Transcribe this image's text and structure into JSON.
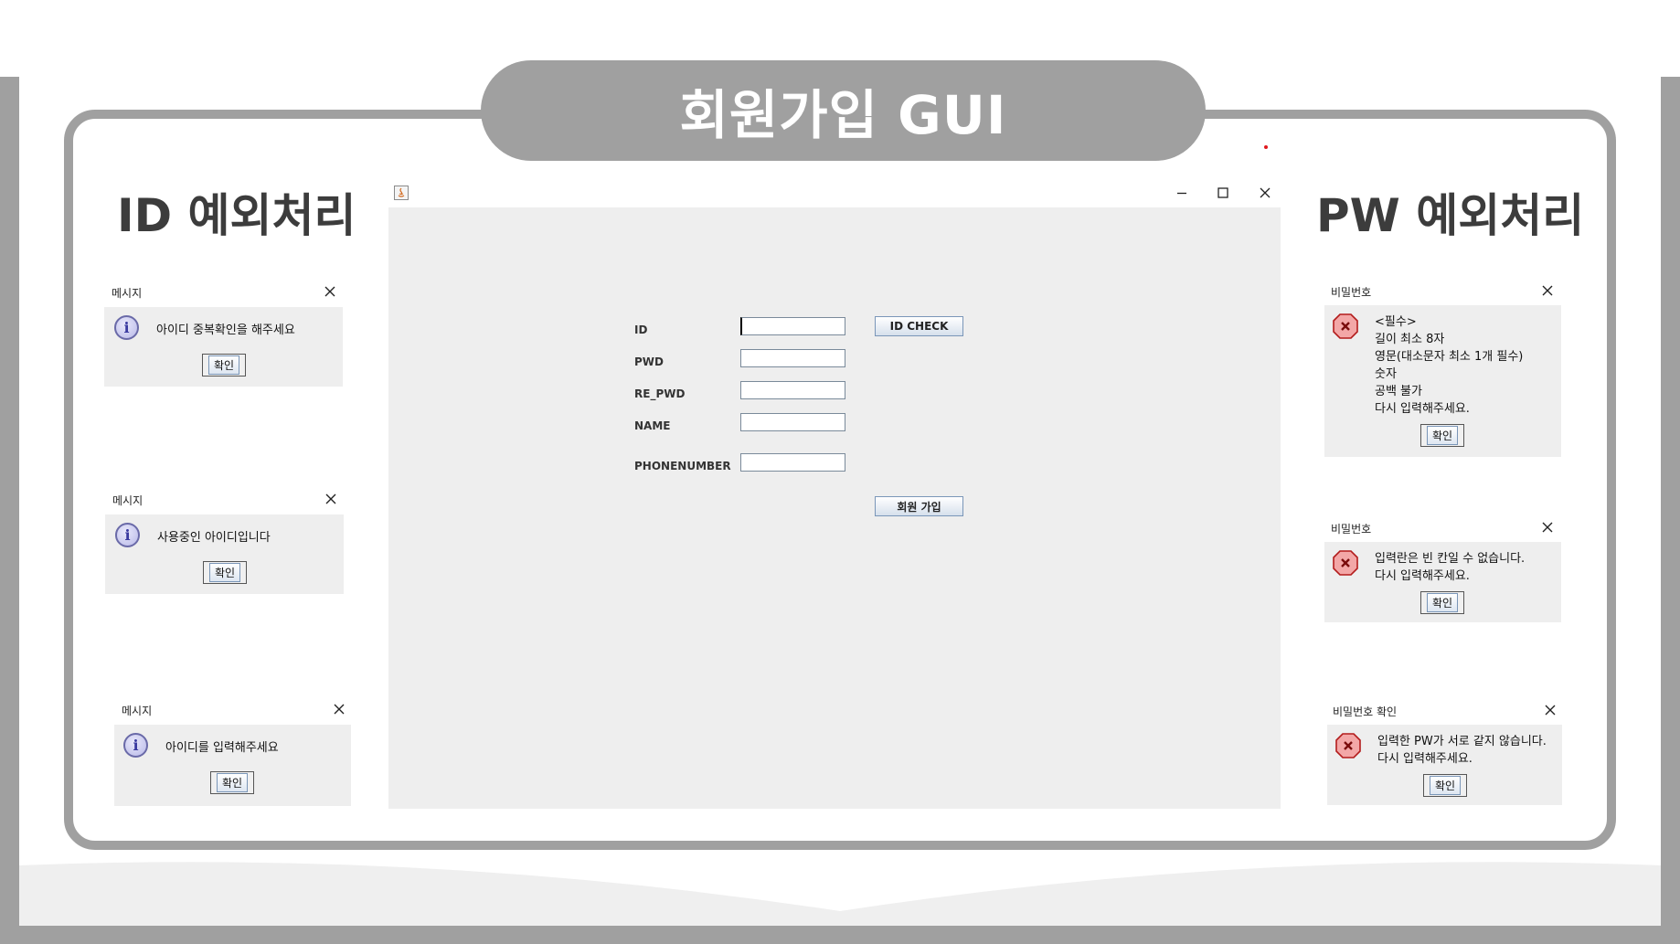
{
  "banner": {
    "title": "회원가입 GUI"
  },
  "sections": {
    "id_title": "ID 예외처리",
    "pw_title": "PW 예외처리"
  },
  "id_dialogs": [
    {
      "title": "메시지",
      "message": "아이디 중복확인을 해주세요",
      "button": "확인",
      "icon": "info-icon"
    },
    {
      "title": "메시지",
      "message": "사용중인 아이디입니다",
      "button": "확인",
      "icon": "info-icon"
    },
    {
      "title": "메시지",
      "message": "아이디를 입력해주세요",
      "button": "확인",
      "icon": "info-icon"
    }
  ],
  "pw_dialogs": [
    {
      "title": "비밀번호",
      "lines": [
        "<필수>",
        "길이 최소 8자",
        "영문(대소문자 최소 1개 필수)",
        "숫자",
        "공백 불가",
        "다시 입력해주세요."
      ],
      "button": "확인",
      "icon": "error-icon"
    },
    {
      "title": "비밀번호",
      "lines": [
        "입력란은 빈 칸일 수 없습니다.",
        "다시 입력해주세요."
      ],
      "button": "확인",
      "icon": "error-icon"
    },
    {
      "title": "비밀번호 확인",
      "lines": [
        "입력한 PW가 서로 같지 않습니다.",
        "다시 입력해주세요."
      ],
      "button": "확인",
      "icon": "error-icon"
    }
  ],
  "window": {
    "controls": [
      "minimize-icon",
      "maximize-icon",
      "close-icon"
    ],
    "form": {
      "fields": [
        {
          "label": "ID",
          "value": ""
        },
        {
          "label": "PWD",
          "value": ""
        },
        {
          "label": "RE_PWD",
          "value": ""
        },
        {
          "label": "NAME",
          "value": ""
        },
        {
          "label": "PHONENUMBER",
          "value": ""
        }
      ],
      "id_check_button": "ID CHECK",
      "submit_button": "회원 가입"
    }
  },
  "colors": {
    "frame": "#a0a0a0",
    "window_bg": "#eeeeee",
    "title_text": "#ffffff",
    "heading_text": "#3c3c3c",
    "error_red": "#e0181e"
  }
}
